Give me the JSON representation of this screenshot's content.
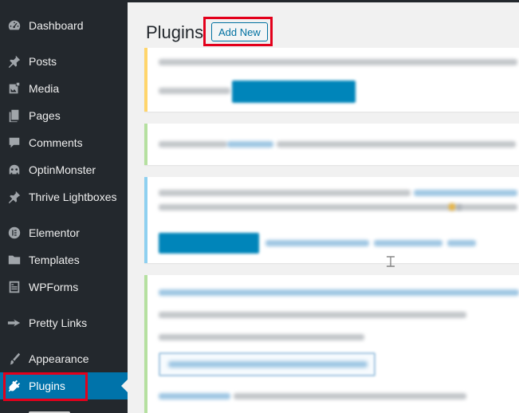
{
  "sidebar": {
    "items": [
      {
        "label": "Dashboard",
        "icon": "dashboard-icon"
      },
      {
        "label": "Posts",
        "icon": "pushpin-icon"
      },
      {
        "label": "Media",
        "icon": "media-icon"
      },
      {
        "label": "Pages",
        "icon": "pages-icon"
      },
      {
        "label": "Comments",
        "icon": "comment-icon"
      },
      {
        "label": "OptinMonster",
        "icon": "monster-icon"
      },
      {
        "label": "Thrive Lightboxes",
        "icon": "pushpin-icon"
      },
      {
        "label": "Elementor",
        "icon": "elementor-icon"
      },
      {
        "label": "Templates",
        "icon": "folder-icon"
      },
      {
        "label": "WPForms",
        "icon": "form-icon"
      },
      {
        "label": "Pretty Links",
        "icon": "star-icon"
      },
      {
        "label": "Appearance",
        "icon": "brush-icon"
      },
      {
        "label": "Plugins",
        "icon": "plug-icon",
        "active": true
      }
    ]
  },
  "main": {
    "title": "Plugins",
    "add_new_label": "Add New"
  },
  "colors": {
    "sidebar_bg": "#23282d",
    "active_bg": "#0073aa",
    "highlight": "#e3001b",
    "notice_yellow": "#ffd56b",
    "notice_green": "#b5e0a0",
    "notice_blue": "#8ed0f0"
  }
}
